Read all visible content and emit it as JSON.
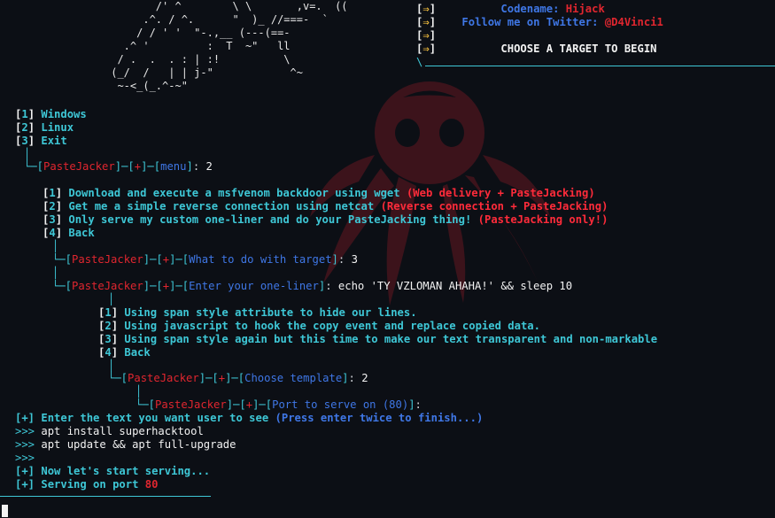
{
  "banner": {
    "arrow": "⇒",
    "codename_label": "Codename:",
    "codename_value": "Hijack",
    "twitter_label": "Follow me on Twitter:",
    "twitter_handle": "@D4Vinci1",
    "choose_target": "CHOOSE A TARGET TO BEGIN"
  },
  "main_menu": [
    {
      "num": "1",
      "label": "Windows"
    },
    {
      "num": "2",
      "label": "Linux"
    },
    {
      "num": "3",
      "label": "Exit"
    }
  ],
  "prompt_name": "PasteJacker",
  "prompt_mark": "+",
  "menu_prompt": {
    "label": "menu",
    "answer": "2"
  },
  "target_options": [
    {
      "num": "1",
      "text": "Download and execute a msfvenom backdoor using wget",
      "note": "(Web delivery + PasteJacking)"
    },
    {
      "num": "2",
      "text": "Get me a simple reverse connection using netcat",
      "note": "(Reverse connection + PasteJacking)"
    },
    {
      "num": "3",
      "text": "Only serve my custom one-liner and do your PasteJacking thing!",
      "note": "(PasteJacking only!)"
    },
    {
      "num": "4",
      "text": "Back",
      "note": ""
    }
  ],
  "target_prompt": {
    "label": "What to do with target",
    "answer": "3"
  },
  "oneliner_prompt": {
    "label": "Enter your one-liner",
    "answer": "echo 'TY VZLOMAN AHAHA!' && sleep 10"
  },
  "template_options": [
    {
      "num": "1",
      "text": "Using span style attribute to hide our lines."
    },
    {
      "num": "2",
      "text": "Using javascript to hook the copy event and replace copied data."
    },
    {
      "num": "3",
      "text": "Using span style again but this time to make our text transparent and non-markable"
    },
    {
      "num": "4",
      "text": "Back"
    }
  ],
  "template_prompt": {
    "label": "Choose template",
    "answer": "2"
  },
  "port_prompt": {
    "label": "Port to serve on (80)",
    "answer": ""
  },
  "enter_text": {
    "tag": "[+]",
    "text": "Enter the text you want user to see",
    "note": "(Press enter twice to finish...)"
  },
  "user_lines": [
    {
      "prompt": ">>>",
      "text": "apt install superhacktool"
    },
    {
      "prompt": ">>>",
      "text": "apt update && apt full-upgrade"
    },
    {
      "prompt": ">>>",
      "text": ""
    }
  ],
  "status_lines": [
    {
      "tag": "[+]",
      "text": "Now let's start serving...",
      "port": ""
    },
    {
      "tag": "[+]",
      "text": "Serving on port",
      "port": "80"
    }
  ],
  "colors": {
    "background": "#0c0f15",
    "cyan": "#3ec7d6",
    "red": "#e0262f",
    "blue": "#3f77e6"
  }
}
